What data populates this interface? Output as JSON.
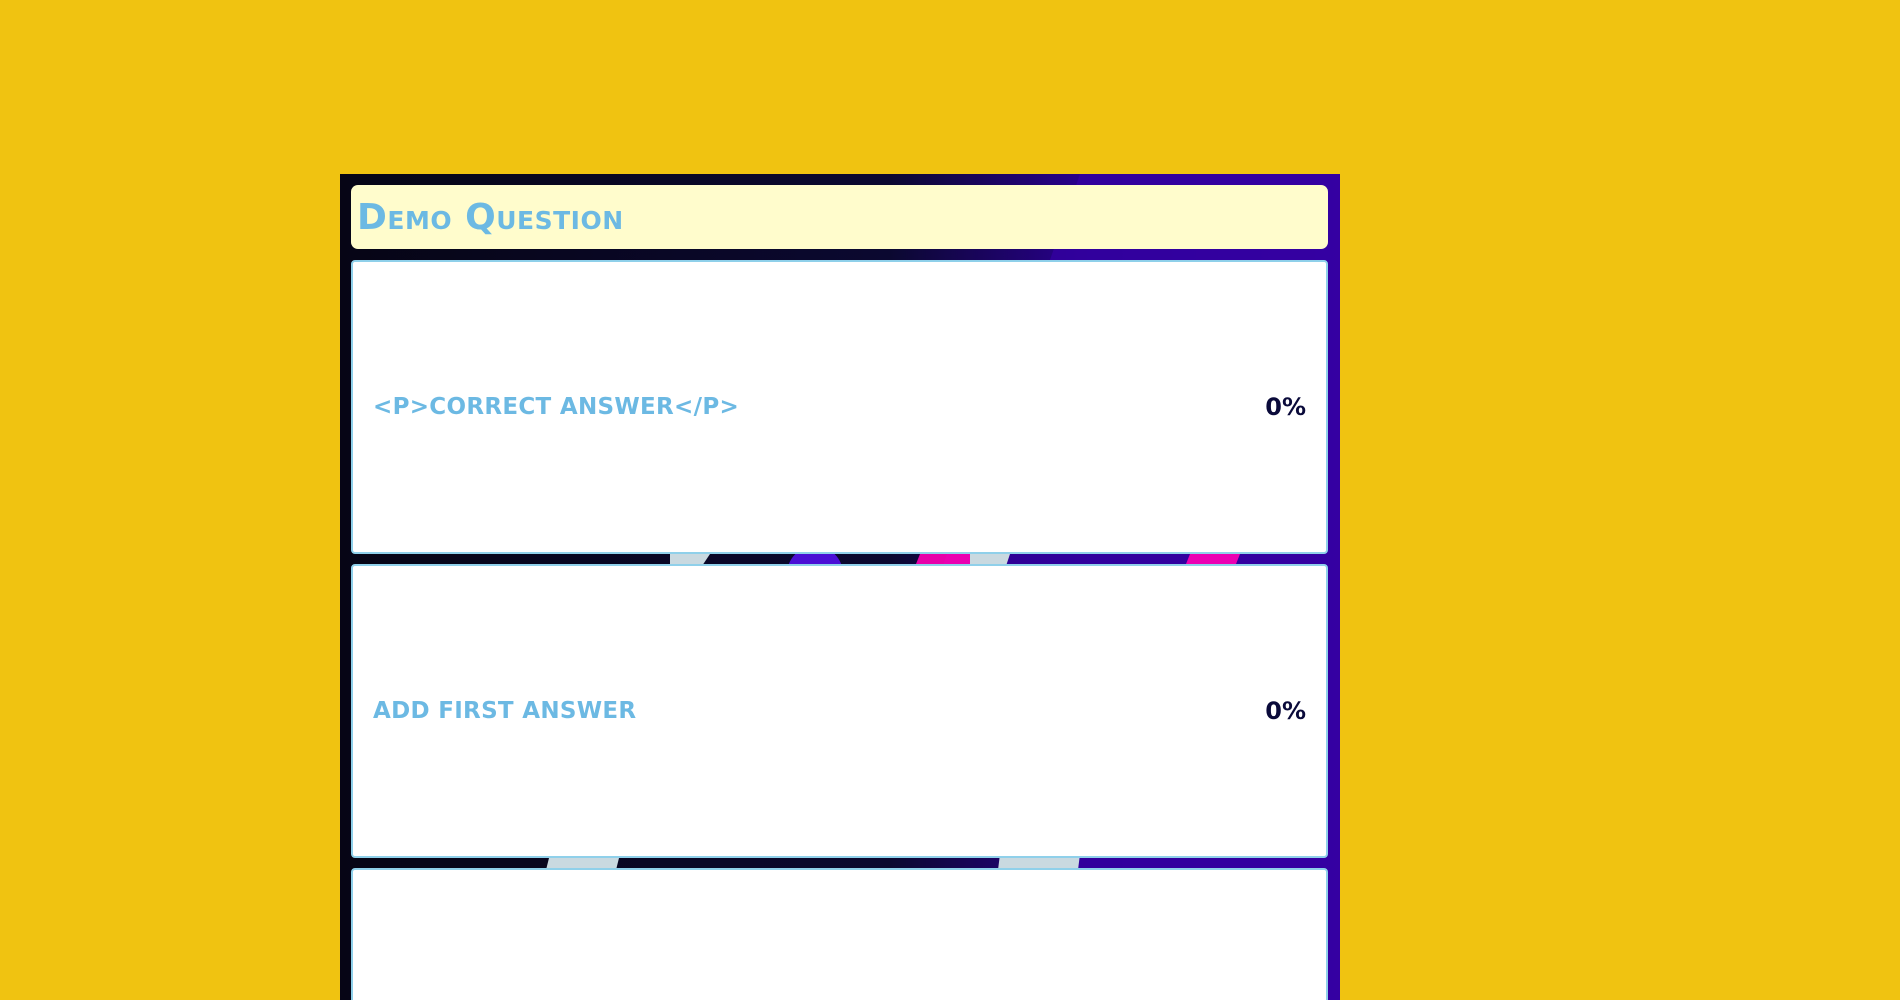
{
  "question": {
    "title": "Demo Question"
  },
  "answers": [
    {
      "label": "<p>correct answer</p>",
      "percent": "0%"
    },
    {
      "label": "Add first answer",
      "percent": "0%"
    },
    {
      "label": "",
      "percent": ""
    }
  ],
  "colors": {
    "page_background": "#f0c311",
    "stage_background": "#050414",
    "stage_accent": "#3a00a8",
    "question_bar": "#fffccc",
    "answer_text": "#6cb9e3",
    "percent_text": "#0a0a3a",
    "card_border": "#8fd0ea"
  }
}
